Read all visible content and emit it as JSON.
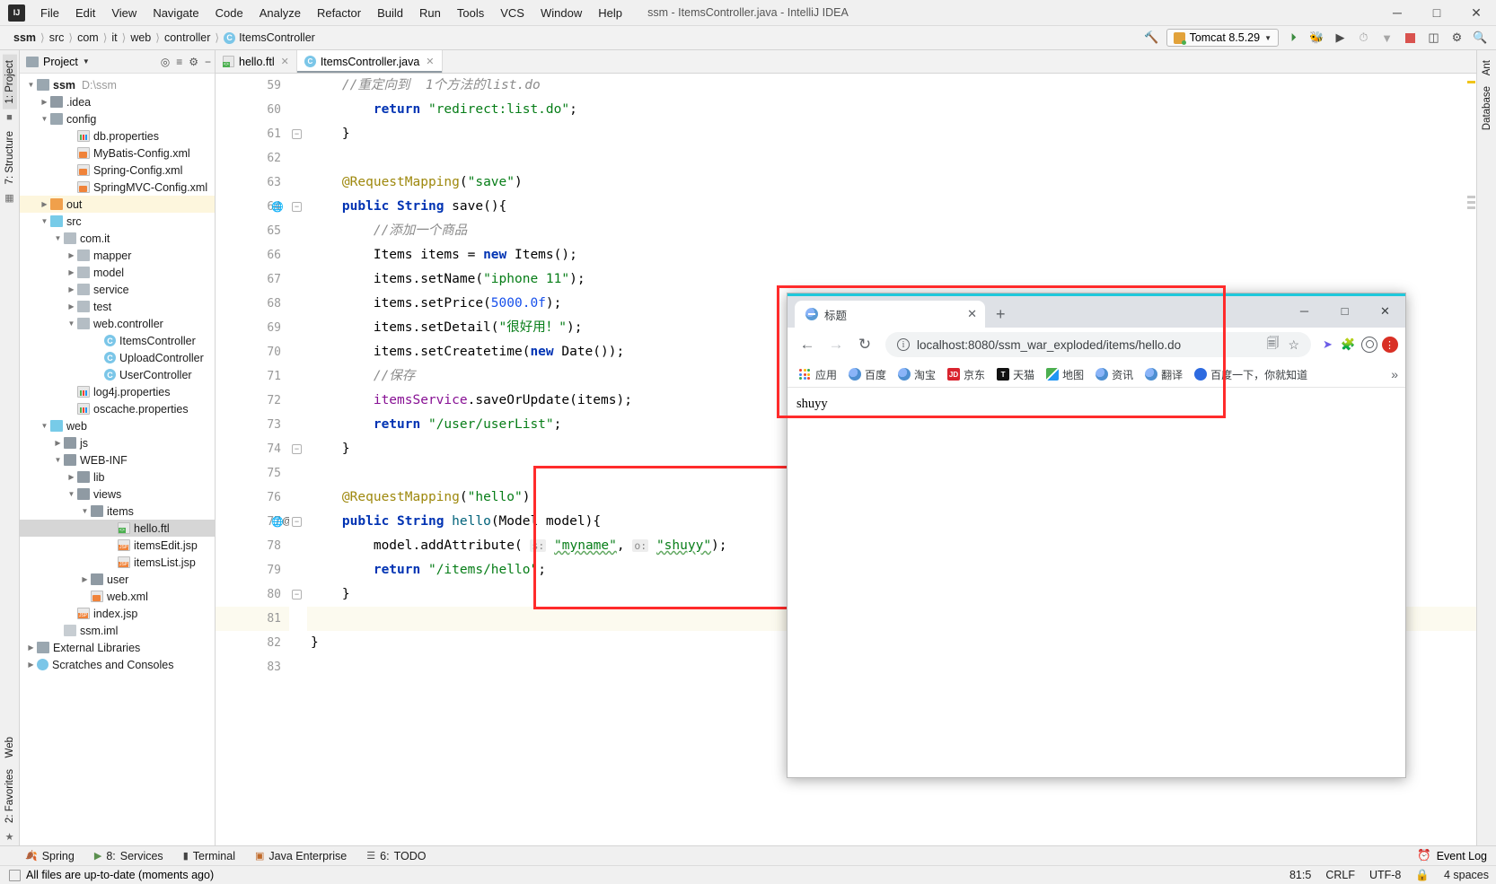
{
  "window": {
    "title": "ssm - ItemsController.java - IntelliJ IDEA",
    "logo": "intellij-idea-logo",
    "minimize": "─",
    "maximize": "□",
    "close": "✕"
  },
  "menubar": [
    {
      "label": "File"
    },
    {
      "label": "Edit"
    },
    {
      "label": "View"
    },
    {
      "label": "Navigate"
    },
    {
      "label": "Code"
    },
    {
      "label": "Analyze"
    },
    {
      "label": "Refactor"
    },
    {
      "label": "Build"
    },
    {
      "label": "Run"
    },
    {
      "label": "Tools"
    },
    {
      "label": "VCS"
    },
    {
      "label": "Window"
    },
    {
      "label": "Help"
    }
  ],
  "breadcrumb": [
    {
      "label": "ssm",
      "bold": true
    },
    {
      "label": "src"
    },
    {
      "label": "com"
    },
    {
      "label": "it"
    },
    {
      "label": "web"
    },
    {
      "label": "controller"
    },
    {
      "label": "ItemsController",
      "badge": "C"
    }
  ],
  "toolbar": {
    "build_hammer": "build-icon",
    "run_config": "Tomcat 8.5.29",
    "run_label": "run-icon",
    "debug_label": "debug-icon",
    "coverage_label": "run-with-coverage-icon",
    "profile_label": "profile-icon",
    "stop_label": "stop-icon",
    "layout_label": "toggle-layout-icon",
    "settings_label": "settings-icon",
    "search_label": "search-everywhere-icon"
  },
  "left_strip": [
    {
      "label": "1: Project",
      "selected": true
    },
    {
      "label": "7: Structure",
      "selected": false
    },
    {
      "label": "Web",
      "selected": false
    },
    {
      "label": "2: Favorites",
      "selected": false
    }
  ],
  "right_strip": [
    {
      "label": "Ant"
    },
    {
      "label": "Database"
    }
  ],
  "project_panel": {
    "title": "Project",
    "chevron": "▾",
    "actions": [
      "locate-icon",
      "collapse-all-icon",
      "settings-icon",
      "hide-icon"
    ],
    "tree": [
      {
        "depth": 0,
        "arrow": "▼",
        "icon": "folder-module",
        "label": "ssm",
        "bold": true,
        "sub": "D:\\ssm"
      },
      {
        "depth": 1,
        "arrow": "▶",
        "icon": "folder",
        "label": ".idea"
      },
      {
        "depth": 1,
        "arrow": "▼",
        "icon": "folder-src",
        "label": "config"
      },
      {
        "depth": 3,
        "arrow": "",
        "icon": "properties",
        "label": "db.properties"
      },
      {
        "depth": 3,
        "arrow": "",
        "icon": "xml",
        "label": "MyBatis-Config.xml"
      },
      {
        "depth": 3,
        "arrow": "",
        "icon": "xml",
        "label": "Spring-Config.xml"
      },
      {
        "depth": 3,
        "arrow": "",
        "icon": "xml",
        "label": "SpringMVC-Config.xml"
      },
      {
        "depth": 1,
        "arrow": "▶",
        "icon": "folder-orange",
        "label": "out",
        "highlight": true
      },
      {
        "depth": 1,
        "arrow": "▼",
        "icon": "folder-blue",
        "label": "src"
      },
      {
        "depth": 2,
        "arrow": "▼",
        "icon": "package",
        "label": "com.it"
      },
      {
        "depth": 3,
        "arrow": "▶",
        "icon": "package",
        "label": "mapper"
      },
      {
        "depth": 3,
        "arrow": "▶",
        "icon": "package",
        "label": "model"
      },
      {
        "depth": 3,
        "arrow": "▶",
        "icon": "package",
        "label": "service"
      },
      {
        "depth": 3,
        "arrow": "▶",
        "icon": "package",
        "label": "test"
      },
      {
        "depth": 3,
        "arrow": "▼",
        "icon": "package",
        "label": "web.controller"
      },
      {
        "depth": 5,
        "arrow": "",
        "icon": "class",
        "label": "ItemsController"
      },
      {
        "depth": 5,
        "arrow": "",
        "icon": "class",
        "label": "UploadController"
      },
      {
        "depth": 5,
        "arrow": "",
        "icon": "class",
        "label": "UserController"
      },
      {
        "depth": 3,
        "arrow": "",
        "icon": "properties",
        "label": "log4j.properties"
      },
      {
        "depth": 3,
        "arrow": "",
        "icon": "properties",
        "label": "oscache.properties"
      },
      {
        "depth": 1,
        "arrow": "▼",
        "icon": "folder-web",
        "label": "web"
      },
      {
        "depth": 2,
        "arrow": "▶",
        "icon": "folder",
        "label": "js"
      },
      {
        "depth": 2,
        "arrow": "▼",
        "icon": "folder",
        "label": "WEB-INF"
      },
      {
        "depth": 3,
        "arrow": "▶",
        "icon": "folder",
        "label": "lib"
      },
      {
        "depth": 3,
        "arrow": "▼",
        "icon": "folder",
        "label": "views"
      },
      {
        "depth": 4,
        "arrow": "▼",
        "icon": "folder",
        "label": "items"
      },
      {
        "depth": 6,
        "arrow": "",
        "icon": "ftl",
        "label": "hello.ftl",
        "selected": true
      },
      {
        "depth": 6,
        "arrow": "",
        "icon": "jsp",
        "label": "itemsEdit.jsp"
      },
      {
        "depth": 6,
        "arrow": "",
        "icon": "jsp",
        "label": "itemsList.jsp"
      },
      {
        "depth": 4,
        "arrow": "▶",
        "icon": "folder",
        "label": "user"
      },
      {
        "depth": 4,
        "arrow": "",
        "icon": "xml",
        "label": "web.xml"
      },
      {
        "depth": 3,
        "arrow": "",
        "icon": "jsp",
        "label": "index.jsp"
      },
      {
        "depth": 2,
        "arrow": "",
        "icon": "iml",
        "label": "ssm.iml"
      },
      {
        "depth": 0,
        "arrow": "▶",
        "icon": "library",
        "label": "External Libraries"
      },
      {
        "depth": 0,
        "arrow": "▶",
        "icon": "scratch",
        "label": "Scratches and Consoles"
      }
    ]
  },
  "editor": {
    "tabs": [
      {
        "label": "hello.ftl",
        "icon": "ftl",
        "active": false,
        "close": "✕"
      },
      {
        "label": "ItemsController.java",
        "icon": "java",
        "active": true,
        "close": "✕"
      }
    ],
    "first_line": 59,
    "current_line": 81,
    "lines": [
      {
        "n": 59,
        "segments": [
          {
            "t": "    //重定向到  1个方法的list.do",
            "c": "cmt"
          }
        ]
      },
      {
        "n": 60,
        "segments": [
          {
            "t": "        ",
            "c": ""
          },
          {
            "t": "return",
            "c": "kw"
          },
          {
            "t": " ",
            "c": ""
          },
          {
            "t": "\"redirect:list.do\"",
            "c": "str"
          },
          {
            "t": ";",
            "c": ""
          }
        ]
      },
      {
        "n": 61,
        "segments": [
          {
            "t": "    }",
            "c": ""
          }
        ],
        "fold": "minus"
      },
      {
        "n": 62,
        "segments": [
          {
            "t": "",
            "c": ""
          }
        ]
      },
      {
        "n": 63,
        "segments": [
          {
            "t": "    ",
            "c": ""
          },
          {
            "t": "@RequestMapping",
            "c": "ann"
          },
          {
            "t": "(",
            "c": ""
          },
          {
            "t": "\"save\"",
            "c": "str"
          },
          {
            "t": ")",
            "c": ""
          }
        ]
      },
      {
        "n": 64,
        "segments": [
          {
            "t": "    ",
            "c": ""
          },
          {
            "t": "public",
            "c": "kw"
          },
          {
            "t": " ",
            "c": ""
          },
          {
            "t": "String",
            "c": "kw"
          },
          {
            "t": " save(){",
            "c": ""
          }
        ],
        "gutter_icon": "web-mapping-icon",
        "fold": "minus"
      },
      {
        "n": 65,
        "segments": [
          {
            "t": "        //添加一个商品",
            "c": "cmt"
          }
        ]
      },
      {
        "n": 66,
        "segments": [
          {
            "t": "        Items items = ",
            "c": ""
          },
          {
            "t": "new",
            "c": "kw"
          },
          {
            "t": " Items();",
            "c": ""
          }
        ]
      },
      {
        "n": 67,
        "segments": [
          {
            "t": "        items.setName(",
            "c": ""
          },
          {
            "t": "\"iphone 11\"",
            "c": "str"
          },
          {
            "t": ");",
            "c": ""
          }
        ]
      },
      {
        "n": 68,
        "segments": [
          {
            "t": "        items.setPrice(",
            "c": ""
          },
          {
            "t": "5000.0f",
            "c": "num"
          },
          {
            "t": ");",
            "c": ""
          }
        ]
      },
      {
        "n": 69,
        "segments": [
          {
            "t": "        items.setDetail(",
            "c": ""
          },
          {
            "t": "\"很好用！\"",
            "c": "str"
          },
          {
            "t": ");",
            "c": ""
          }
        ]
      },
      {
        "n": 70,
        "segments": [
          {
            "t": "        items.setCreatetime(",
            "c": ""
          },
          {
            "t": "new",
            "c": "kw"
          },
          {
            "t": " Date());",
            "c": ""
          }
        ]
      },
      {
        "n": 71,
        "segments": [
          {
            "t": "        //保存",
            "c": "cmt"
          }
        ]
      },
      {
        "n": 72,
        "segments": [
          {
            "t": "        ",
            "c": ""
          },
          {
            "t": "itemsService",
            "c": "fld"
          },
          {
            "t": ".saveOrUpdate(items);",
            "c": ""
          }
        ]
      },
      {
        "n": 73,
        "segments": [
          {
            "t": "        ",
            "c": ""
          },
          {
            "t": "return",
            "c": "kw"
          },
          {
            "t": " ",
            "c": ""
          },
          {
            "t": "\"/user/userList\"",
            "c": "str"
          },
          {
            "t": ";",
            "c": ""
          }
        ]
      },
      {
        "n": 74,
        "segments": [
          {
            "t": "    }",
            "c": ""
          }
        ],
        "fold": "minus"
      },
      {
        "n": 75,
        "segments": [
          {
            "t": "",
            "c": ""
          }
        ]
      },
      {
        "n": 76,
        "segments": [
          {
            "t": "    ",
            "c": ""
          },
          {
            "t": "@RequestMapping",
            "c": "ann"
          },
          {
            "t": "(",
            "c": ""
          },
          {
            "t": "\"hello\"",
            "c": "str"
          },
          {
            "t": ")",
            "c": ""
          }
        ]
      },
      {
        "n": 77,
        "segments": [
          {
            "t": "    ",
            "c": ""
          },
          {
            "t": "public",
            "c": "kw"
          },
          {
            "t": " ",
            "c": ""
          },
          {
            "t": "String",
            "c": "kw"
          },
          {
            "t": " ",
            "c": ""
          },
          {
            "t": "hello",
            "c": "mth"
          },
          {
            "t": "(Model model){",
            "c": ""
          }
        ],
        "gutter_icon": "web-mapping-icon",
        "gutter_icon2": "@",
        "fold": "minus"
      },
      {
        "n": 78,
        "segments": [
          {
            "t": "        model.addAttribute( ",
            "c": ""
          },
          {
            "t": "s:",
            "c": "hint"
          },
          {
            "t": " ",
            "c": ""
          },
          {
            "t": "\"myname\"",
            "c": "str sqg"
          },
          {
            "t": ", ",
            "c": ""
          },
          {
            "t": "o:",
            "c": "hint"
          },
          {
            "t": " ",
            "c": ""
          },
          {
            "t": "\"shuyy\"",
            "c": "str sqg"
          },
          {
            "t": ");",
            "c": ""
          }
        ]
      },
      {
        "n": 79,
        "segments": [
          {
            "t": "        ",
            "c": ""
          },
          {
            "t": "return",
            "c": "kw"
          },
          {
            "t": " ",
            "c": ""
          },
          {
            "t": "\"/items/hello\"",
            "c": "str"
          },
          {
            "t": ";",
            "c": ""
          }
        ]
      },
      {
        "n": 80,
        "segments": [
          {
            "t": "    }",
            "c": ""
          }
        ],
        "fold": "minus"
      },
      {
        "n": 81,
        "segments": [
          {
            "t": "",
            "c": ""
          }
        ],
        "current": true
      },
      {
        "n": 82,
        "segments": [
          {
            "t": "}",
            "c": ""
          }
        ]
      },
      {
        "n": 83,
        "segments": [
          {
            "t": "",
            "c": ""
          }
        ]
      }
    ]
  },
  "bottom_tools": [
    {
      "num": "",
      "label": "Spring",
      "icon": "spring-leaf-icon"
    },
    {
      "num": "8:",
      "label": "Services",
      "icon": "services-icon"
    },
    {
      "num": "",
      "label": "Terminal",
      "icon": "terminal-icon"
    },
    {
      "num": "",
      "label": "Java Enterprise",
      "icon": "java-enterprise-icon"
    },
    {
      "num": "6:",
      "label": "TODO",
      "icon": "todo-icon"
    }
  ],
  "status": {
    "message": "All files are up-to-date (moments ago)",
    "event_log": "Event Log",
    "caret": "81:5",
    "line_sep": "CRLF",
    "encoding": "UTF-8",
    "indent": "4 spaces",
    "lock_icon": "lock-icon",
    "branch_icon": "git-branch-icon"
  },
  "browser": {
    "tab": {
      "title": "标题",
      "favicon": "globe-icon",
      "close": "✕"
    },
    "new_tab": "+",
    "window_controls": {
      "minimize": "─",
      "maximize": "□",
      "close": "✕"
    },
    "nav": {
      "back": "←",
      "forward": "→",
      "reload": "↻"
    },
    "omnibox": {
      "info_icon": "i",
      "url": "localhost:8080/ssm_war_exploded/items/hello.do",
      "translate_icon": "translate-icon",
      "star_icon": "bookmark-star-icon"
    },
    "extensions": [
      "extension-icon",
      "profile-avatar-icon",
      "chrome-menu-icon"
    ],
    "bookmarks": [
      {
        "label": "应用",
        "icon": "apps-grid"
      },
      {
        "label": "百度",
        "icon": "globe"
      },
      {
        "label": "淘宝",
        "icon": "globe"
      },
      {
        "label": "京东",
        "icon": "jd"
      },
      {
        "label": "天猫",
        "icon": "tmall"
      },
      {
        "label": "地图",
        "icon": "map"
      },
      {
        "label": "资讯",
        "icon": "globe"
      },
      {
        "label": "翻译",
        "icon": "globe"
      },
      {
        "label": "百度一下，你就知道",
        "icon": "baidu"
      }
    ],
    "overflow": "»",
    "page_content": "shuyy"
  }
}
